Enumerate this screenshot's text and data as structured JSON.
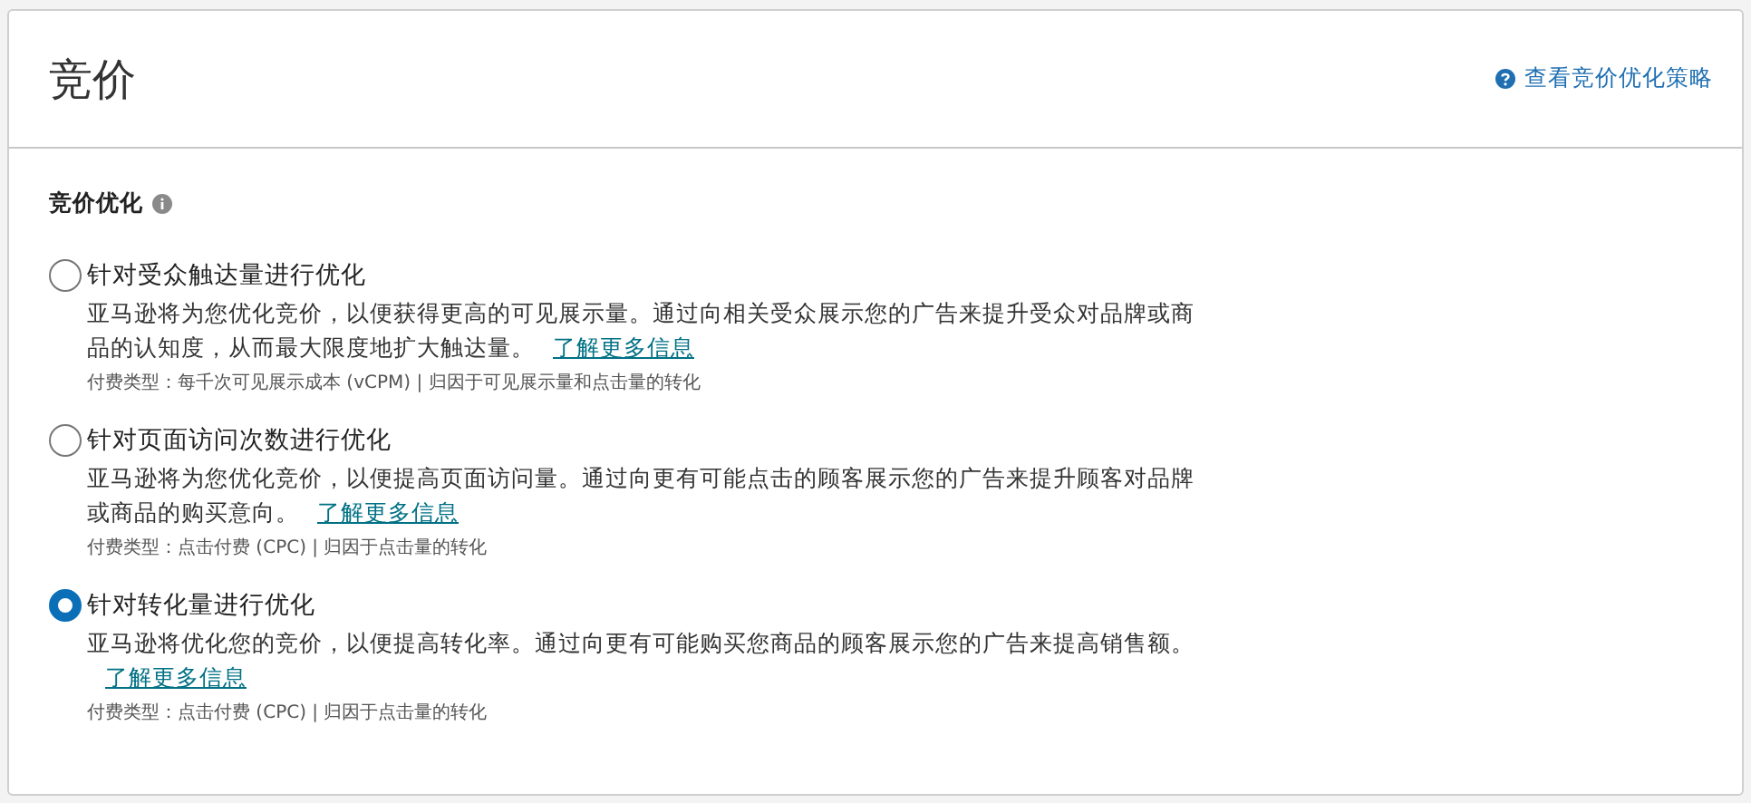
{
  "header": {
    "title": "竞价",
    "help_link": "查看竞价优化策略"
  },
  "section": {
    "heading": "竞价优化"
  },
  "options": [
    {
      "label": "针对受众触达量进行优化",
      "selected": false,
      "description": "亚马逊将为您优化竞价，以便获得更高的可见展示量。通过向相关受众展示您的广告来提升受众对品牌或商品的认知度，从而最大限度地扩大触达量。",
      "link": "了解更多信息",
      "note": "付费类型：每千次可见展示成本 (vCPM) | 归因于可见展示量和点击量的转化"
    },
    {
      "label": "针对页面访问次数进行优化",
      "selected": false,
      "description": "亚马逊将为您优化竞价，以便提高页面访问量。通过向更有可能点击的顾客展示您的广告来提升顾客对品牌或商品的购买意向。",
      "link": "了解更多信息",
      "note": "付费类型：点击付费 (CPC) | 归因于点击量的转化"
    },
    {
      "label": "针对转化量进行优化",
      "selected": true,
      "description": "亚马逊将优化您的竞价，以便提高转化率。通过向更有可能购买您商品的顾客展示您的广告来提高销售额。",
      "link": "了解更多信息",
      "note": "付费类型：点击付费 (CPC) | 归因于点击量的转化"
    }
  ]
}
